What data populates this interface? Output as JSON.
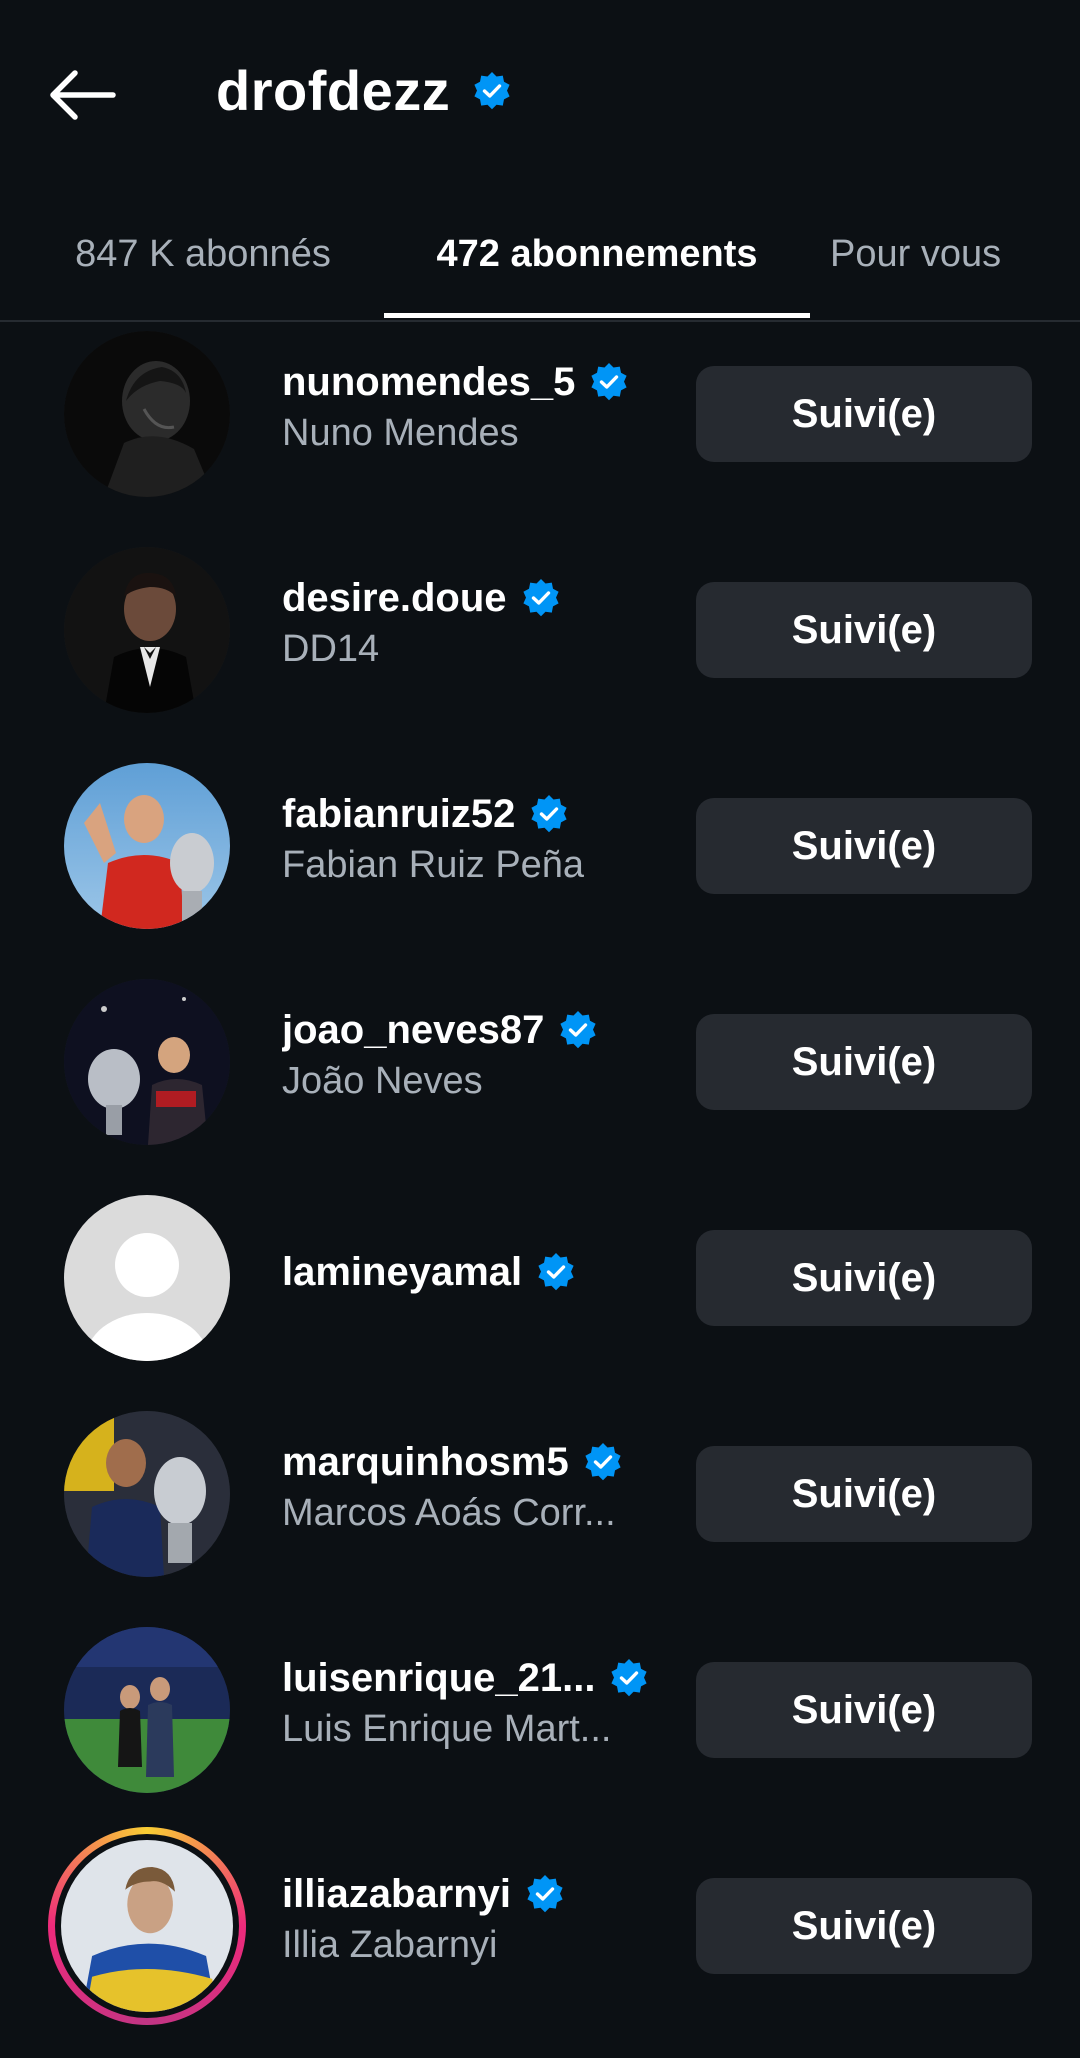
{
  "header": {
    "title": "drofdezz",
    "verified": true
  },
  "tabs": [
    {
      "label": "847 K abonnés",
      "active": false
    },
    {
      "label": "472 abonnements",
      "active": true
    },
    {
      "label": "Pour vous",
      "active": false
    }
  ],
  "accounts": [
    {
      "username": "nunomendes_5",
      "full_name": "Nuno Mendes",
      "button": "Suivi(e)",
      "verified": true,
      "avatar": "bw-portrait"
    },
    {
      "username": "desire.doue",
      "full_name": "DD14",
      "button": "Suivi(e)",
      "verified": true,
      "avatar": "tuxedo-portrait"
    },
    {
      "username": "fabianruiz52",
      "full_name": "Fabian Ruiz Peña",
      "button": "Suivi(e)",
      "verified": true,
      "avatar": "trophy-red-shirt"
    },
    {
      "username": "joao_neves87",
      "full_name": "João Neves",
      "button": "Suivi(e)",
      "verified": true,
      "avatar": "trophy-night"
    },
    {
      "username": "lamineyamal",
      "full_name": "",
      "button": "Suivi(e)",
      "verified": true,
      "avatar": "default-avatar"
    },
    {
      "username": "marquinhosm5",
      "full_name": "Marcos Aoás Corr...",
      "button": "Suivi(e)",
      "verified": true,
      "avatar": "trophy-psg"
    },
    {
      "username": "luisenrique_21...",
      "full_name": "Luis Enrique Mart...",
      "button": "Suivi(e)",
      "verified": true,
      "avatar": "stadium-couple"
    },
    {
      "username": "illiazabarnyi",
      "full_name": "Illia Zabarnyi",
      "button": "Suivi(e)",
      "verified": true,
      "avatar": "flag-portrait",
      "story_ring": true
    }
  ],
  "colors": {
    "background": "#0c1014",
    "verified_blue": "#0095f6",
    "button_bg": "#262a30",
    "secondary_text": "#a8b0b9"
  }
}
